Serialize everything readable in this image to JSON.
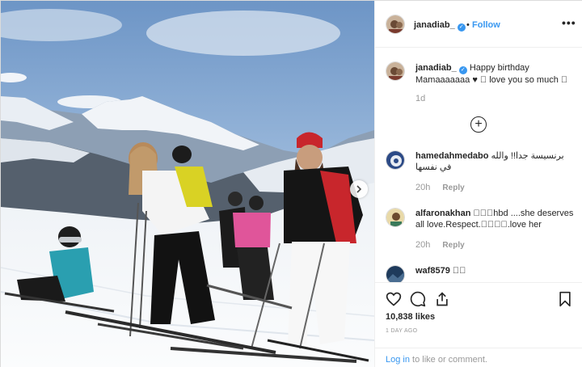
{
  "post": {
    "username": "janadiab_",
    "follow_label": "Follow",
    "separator": "•",
    "more_label": "•••",
    "verified_mark": "✓"
  },
  "caption": {
    "username": "janadiab_",
    "text": "Happy birthday Mamaaaaaaa ♥ 󾓮 love you so much 󾓮",
    "time": "1d"
  },
  "load_more_label": "+",
  "comments": [
    {
      "username": "hamedahmedabo",
      "text": "برنسيسة جدا!! والله في نفسها",
      "time": "20h",
      "reply": "Reply"
    },
    {
      "username": "alfaronakhan",
      "text": "󾓮󾓮󾓮hbd ....she deserves all love.Respect.󾓮󾓮󾓮󾓮.love her",
      "time": "20h",
      "reply": "Reply"
    },
    {
      "username": "waf8579",
      "text": "󾓮󾓮"
    }
  ],
  "likes_count": "10,838 likes",
  "posted_date": "1 DAY AGO",
  "login": {
    "link": "Log in",
    "rest": " to like or comment."
  },
  "icons": [
    "heart-icon",
    "comment-icon",
    "share-icon",
    "bookmark-icon",
    "next-arrow-icon",
    "plus-circle-icon",
    "verified-icon"
  ],
  "colors": {
    "accent": "#3897f0",
    "muted": "#999999",
    "text": "#262626",
    "border": "#efefef"
  }
}
